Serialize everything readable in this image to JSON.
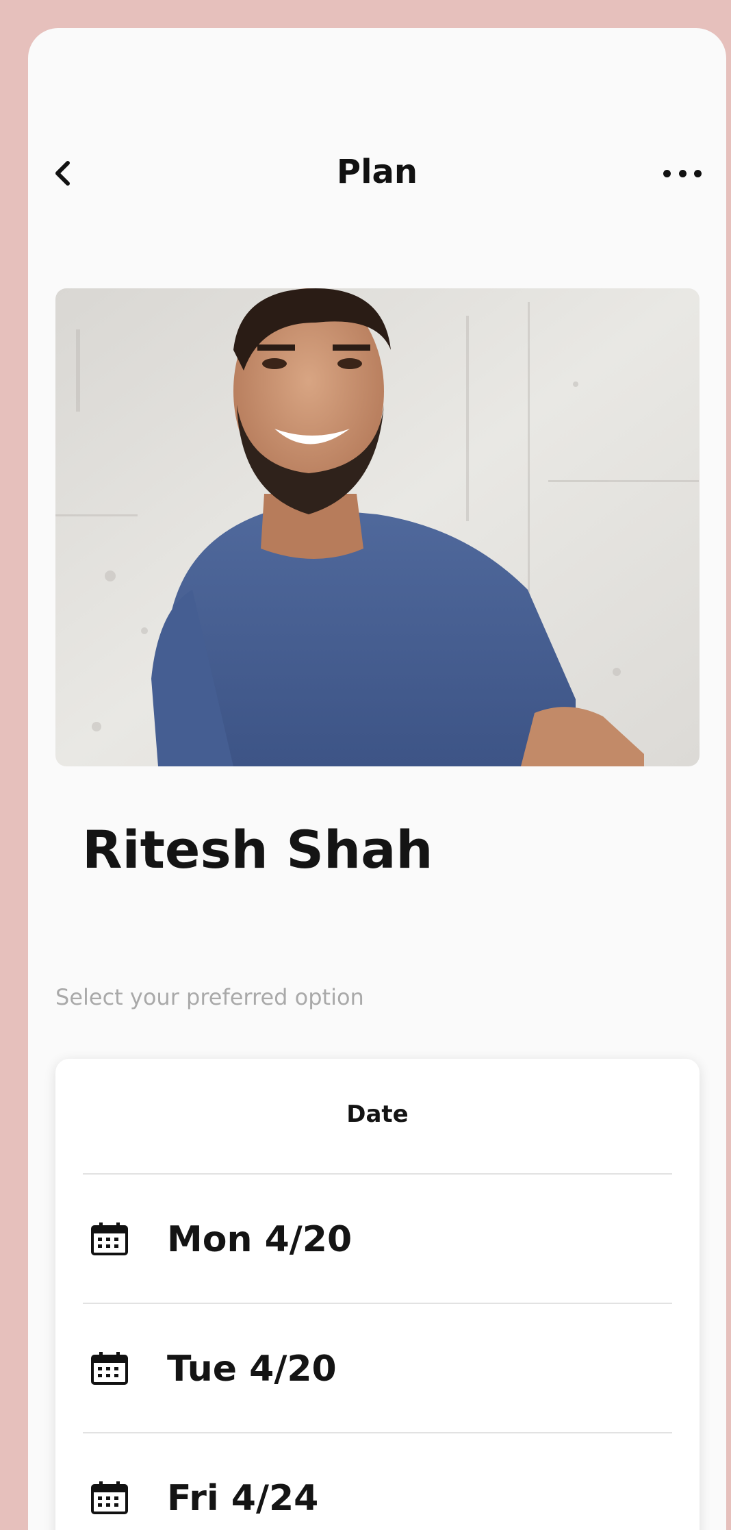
{
  "header": {
    "title": "Plan",
    "back_icon": "chevron-left-icon",
    "more_icon": "more-horizontal-icon"
  },
  "profile": {
    "photo": "profile-photo",
    "name": "Ritesh Shah"
  },
  "prompt": "Select your preferred option",
  "options_card": {
    "title": "Date",
    "items": [
      {
        "label": "Mon 4/20",
        "icon": "calendar-icon"
      },
      {
        "label": "Tue 4/20",
        "icon": "calendar-icon"
      },
      {
        "label": "Fri 4/24",
        "icon": "calendar-icon"
      }
    ]
  },
  "colors": {
    "background": "#e6c0bc",
    "screen": "#fafafa",
    "text": "#141414",
    "muted": "#a9a9a9"
  }
}
